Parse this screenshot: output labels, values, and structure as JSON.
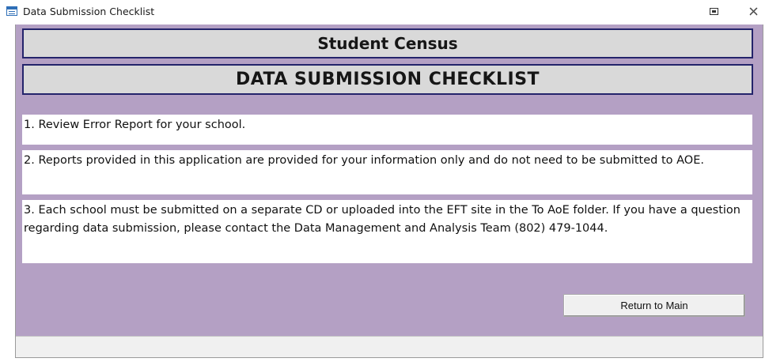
{
  "window": {
    "title": "Data Submission Checklist",
    "icons": {
      "app": "form-icon",
      "restore": "restore-icon",
      "close": "close-icon"
    }
  },
  "form": {
    "heading": "Student Census",
    "subheading": "DATA SUBMISSION CHECKLIST",
    "items": [
      "1. Review Error Report for your school.",
      "2.  Reports provided in this application are provided for your information only and do not need to be submitted to AOE.",
      "3.  Each school must be submitted on a separate CD or uploaded into the EFT site in the To AoE folder. If you have a question regarding data submission, please contact the Data Management and Analysis Team (802) 479-1044."
    ],
    "return_button": "Return to Main"
  },
  "colors": {
    "form_background": "#b4a0c4",
    "header_fill": "#d9d9d9",
    "header_border": "#24246b"
  }
}
